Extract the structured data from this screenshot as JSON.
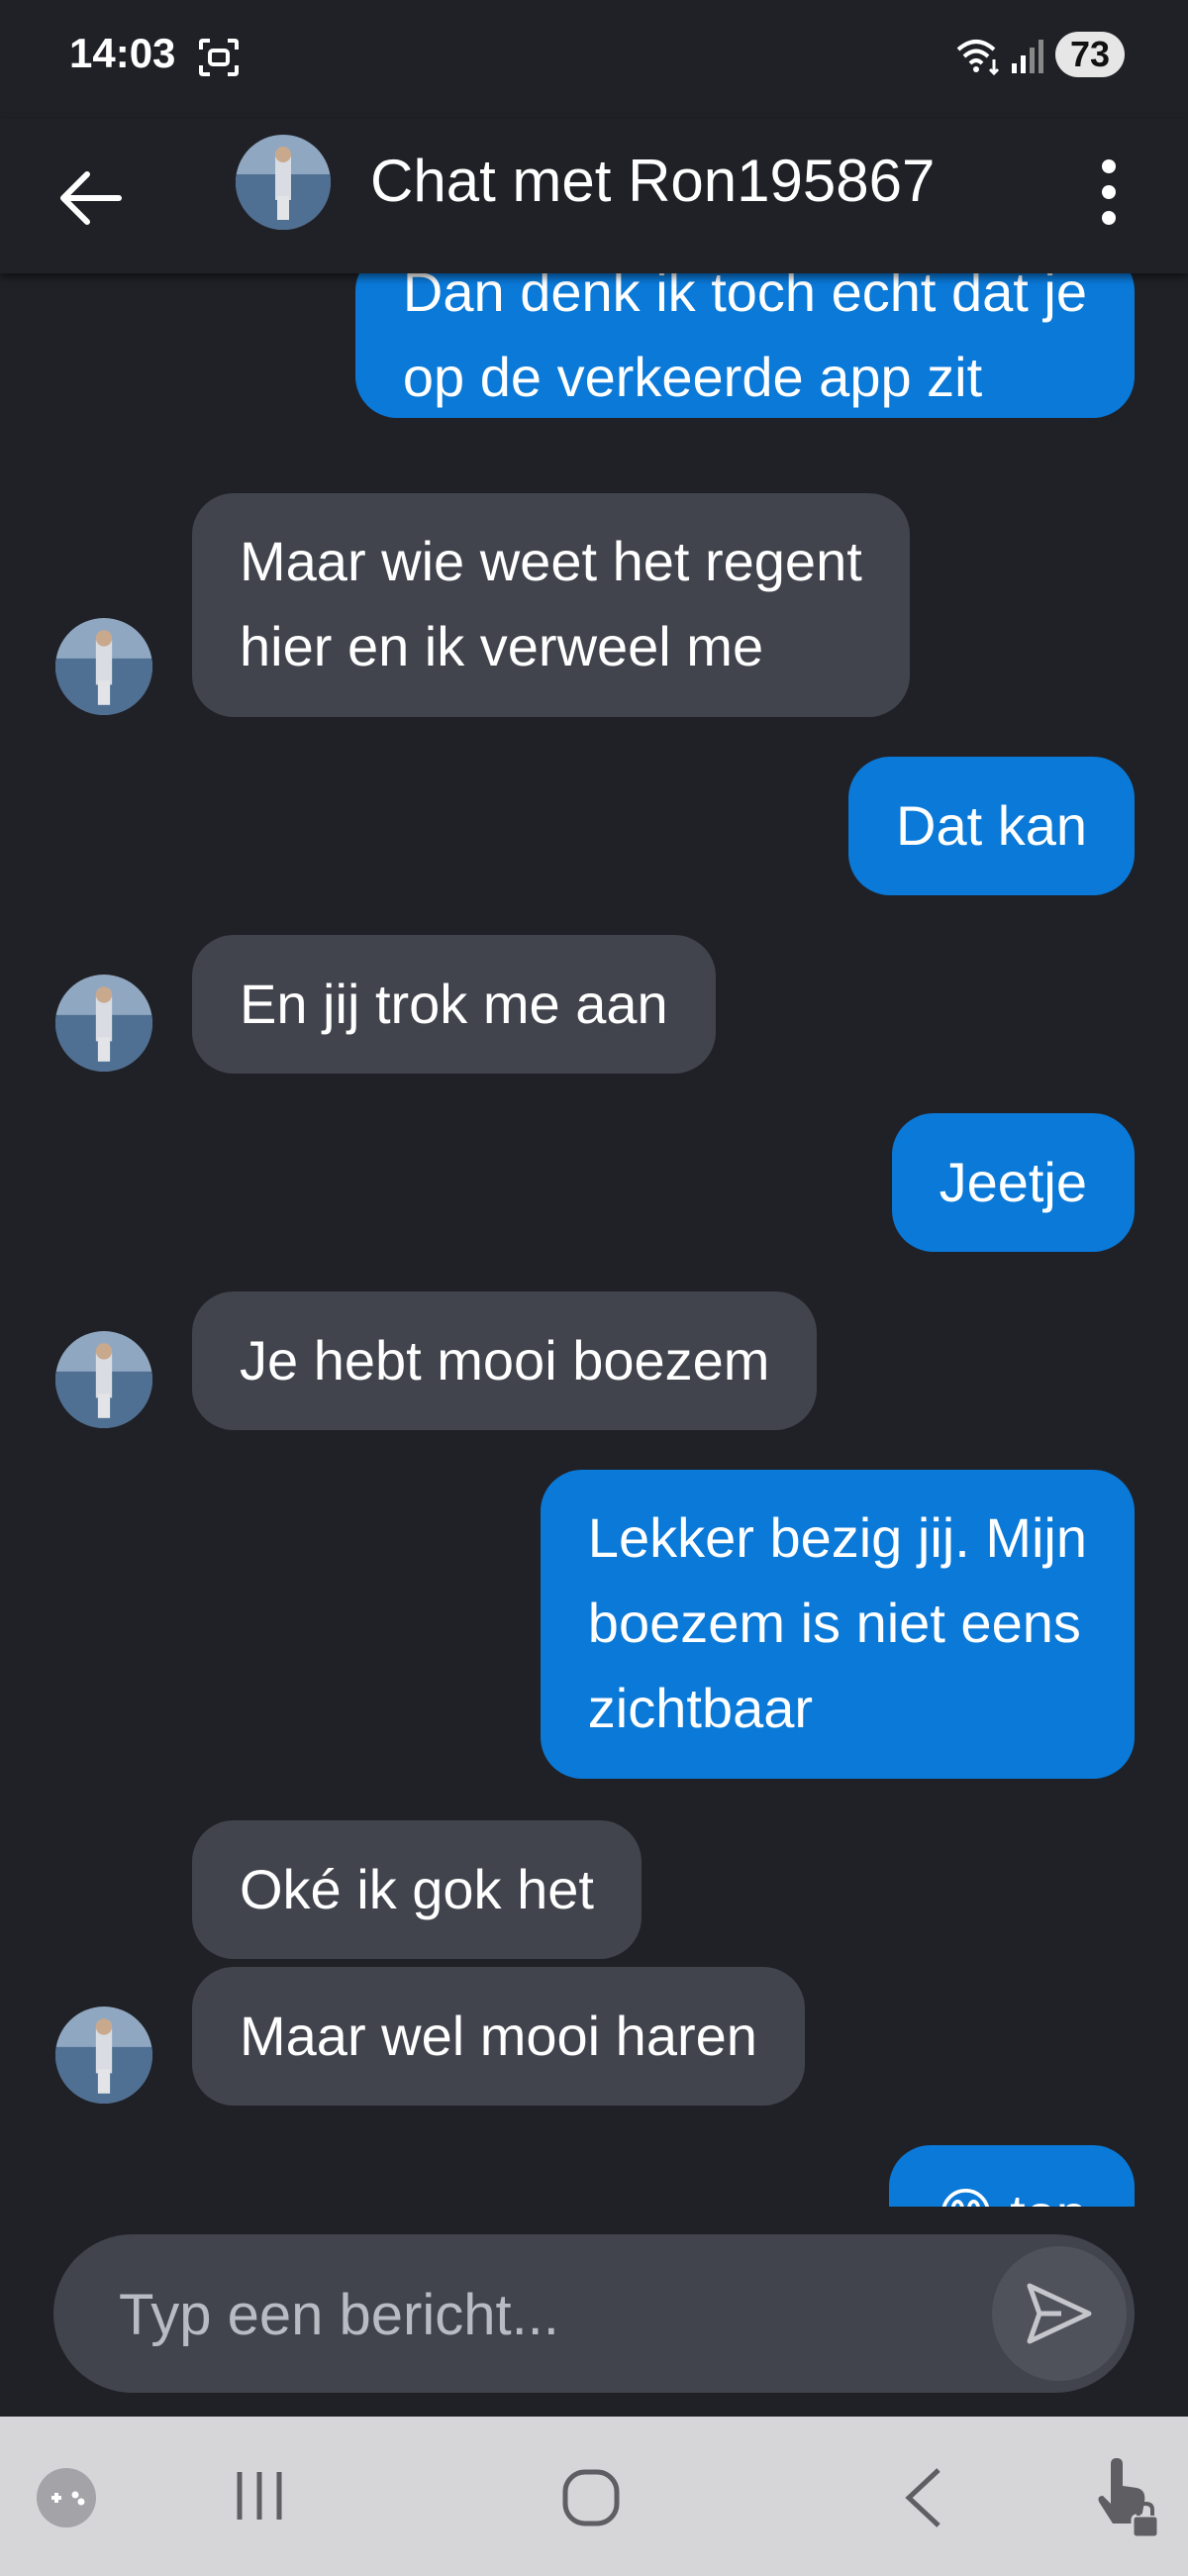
{
  "status_bar": {
    "time": "14:03",
    "battery": "73",
    "icons": [
      "screenshot-icon",
      "wifi-icon",
      "signal-icon"
    ]
  },
  "header": {
    "title": "Chat met Ron195867",
    "back_icon": "back-arrow-icon",
    "menu_icon": "more-vertical-icon"
  },
  "messages": [
    {
      "direction": "out",
      "lines": [
        "Dan denk ik toch echt dat je",
        "op de verkeerde app zit"
      ]
    },
    {
      "direction": "in",
      "lines": [
        "Maar wie weet het regent",
        "hier en ik verweel me"
      ]
    },
    {
      "direction": "out",
      "lines": [
        "Dat kan"
      ]
    },
    {
      "direction": "in",
      "lines": [
        "En jij trok me aan"
      ]
    },
    {
      "direction": "out",
      "lines": [
        "Jeetje"
      ]
    },
    {
      "direction": "in",
      "lines": [
        "Je hebt mooi boezem"
      ]
    },
    {
      "direction": "out",
      "lines": [
        "Lekker bezig jij. Mijn",
        "boezem is niet eens",
        "zichtbaar"
      ]
    },
    {
      "direction": "in",
      "lines": [
        "Oké ik gok het"
      ]
    },
    {
      "direction": "in",
      "lines": [
        "Maar wel mooi haren"
      ]
    },
    {
      "direction": "out",
      "lines": [
        "😊 top"
      ]
    }
  ],
  "composer": {
    "placeholder": "Typ een bericht...",
    "value": "",
    "send_icon": "send-icon"
  },
  "nav_bar": {
    "icons": [
      "game-launcher-icon",
      "recent-apps-icon",
      "home-icon",
      "back-icon",
      "touch-lock-icon"
    ]
  },
  "colors": {
    "background": "#202127",
    "outgoing_bubble": "#0a79d8",
    "incoming_bubble": "#41444d",
    "nav_bar": "#d6d6d9"
  }
}
